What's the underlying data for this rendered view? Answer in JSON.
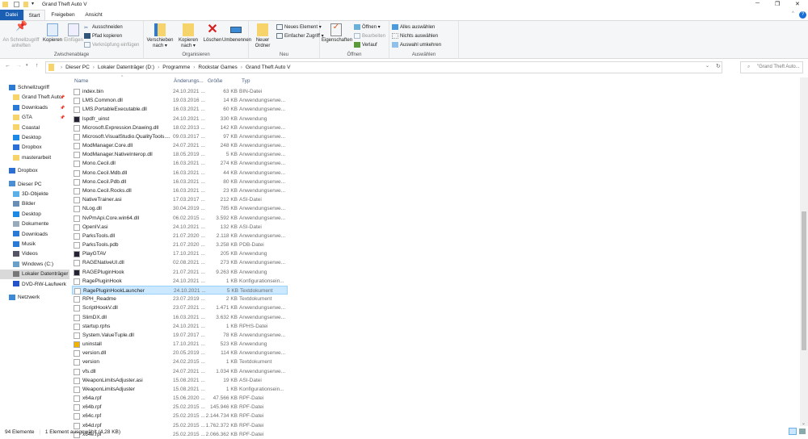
{
  "window": {
    "title": "Grand Theft Auto V",
    "minimize": "─",
    "maximize": "❐",
    "close": "✕"
  },
  "tabs": [
    "Datei",
    "Start",
    "Freigeben",
    "Ansicht"
  ],
  "ribbon": {
    "clipboard": {
      "label": "Zwischenablage",
      "pin": "An Schnellzugriff anheften",
      "copy": "Kopieren",
      "paste": "Einfügen",
      "cut": "Ausschneiden",
      "copy_path": "Pfad kopieren",
      "paste_link": "Verknüpfung einfügen"
    },
    "organize": {
      "label": "Organisieren",
      "move": "Verschieben nach ▾",
      "copyto": "Kopieren nach ▾",
      "delete": "Löschen",
      "rename": "Umbenennen"
    },
    "new": {
      "label": "Neu",
      "folder": "Neuer Ordner",
      "item": "Neues Element ▾",
      "easy": "Einfacher Zugriff ▾"
    },
    "open": {
      "label": "Öffnen",
      "props": "Eigenschaften",
      "open": "Öffnen ▾",
      "edit": "Bearbeiten",
      "history": "Verlauf"
    },
    "select": {
      "label": "Auswählen",
      "all": "Alles auswählen",
      "none": "Nichts auswählen",
      "invert": "Auswahl umkehren"
    }
  },
  "address": {
    "crumbs": [
      "Dieser PC",
      "Lokaler Datenträger (D:)",
      "Programme",
      "Rockstar Games",
      "Grand Theft Auto V"
    ],
    "search_placeholder": "\"Grand Theft Auto..."
  },
  "sidebar": [
    {
      "label": "Schnellzugriff",
      "color": "#2b7bd6",
      "indent": 0
    },
    {
      "label": "Grand Theft Auto",
      "color": "#f7d46b",
      "indent": 1,
      "pin": true
    },
    {
      "label": "Downloads",
      "color": "#2b7bd6",
      "indent": 1,
      "pin": true
    },
    {
      "label": "GTA",
      "color": "#f7d46b",
      "indent": 1,
      "pin": true
    },
    {
      "label": "Coastal",
      "color": "#f7d46b",
      "indent": 1
    },
    {
      "label": "Desktop",
      "color": "#1e88e5",
      "indent": 1
    },
    {
      "label": "Dropbox",
      "color": "#2b6fd6",
      "indent": 1
    },
    {
      "label": "masterarbeit",
      "color": "#f7d46b",
      "indent": 1
    },
    {
      "label": "Dropbox",
      "color": "#2b6fd6",
      "indent": 0,
      "gap": true
    },
    {
      "label": "Dieser PC",
      "color": "#4a8fd6",
      "indent": 0,
      "gap": true
    },
    {
      "label": "3D-Objekte",
      "color": "#5cb0e8",
      "indent": 1
    },
    {
      "label": "Bilder",
      "color": "#6a8fb5",
      "indent": 1
    },
    {
      "label": "Desktop",
      "color": "#1e88e5",
      "indent": 1
    },
    {
      "label": "Dokumente",
      "color": "#9ab",
      "indent": 1
    },
    {
      "label": "Downloads",
      "color": "#2b7bd6",
      "indent": 1
    },
    {
      "label": "Musik",
      "color": "#2b7bd6",
      "indent": 1
    },
    {
      "label": "Videos",
      "color": "#556",
      "indent": 1
    },
    {
      "label": "Windows (C:)",
      "color": "#6aa0c8",
      "indent": 1
    },
    {
      "label": "Lokaler Datenträger",
      "color": "#777",
      "indent": 1,
      "selected": true
    },
    {
      "label": "DVD-RW-Laufwerk",
      "color": "#2452c8",
      "indent": 1
    },
    {
      "label": "Netzwerk",
      "color": "#3c8ad6",
      "indent": 0,
      "gap": true
    }
  ],
  "columns": {
    "name": "Name",
    "date": "Änderungs...",
    "size": "Größe",
    "type": "Typ"
  },
  "files": [
    [
      "index.bin",
      "24.10.2021 ...",
      "63 KB",
      "BIN-Datei"
    ],
    [
      "LMS.Common.dll",
      "19.03.2016 ...",
      "14 KB",
      "Anwendungserwe..."
    ],
    [
      "LMS.PortableExecutable.dll",
      "16.03.2021 ...",
      "60 KB",
      "Anwendungserwe..."
    ],
    [
      "lspdfr_uinst",
      "24.10.2021 ...",
      "330 KB",
      "Anwendung"
    ],
    [
      "Microsoft.Expression.Drawing.dll",
      "18.02.2013 ...",
      "142 KB",
      "Anwendungserwe..."
    ],
    [
      "Microsoft.VisualStudio.QualityTools....",
      "09.03.2017 ...",
      "97 KB",
      "Anwendungserwe..."
    ],
    [
      "ModManager.Core.dll",
      "24.07.2021 ...",
      "248 KB",
      "Anwendungserwe..."
    ],
    [
      "ModManager.NativeInterop.dll",
      "18.05.2019 ...",
      "5 KB",
      "Anwendungserwe..."
    ],
    [
      "Mono.Cecil.dll",
      "16.03.2021 ...",
      "274 KB",
      "Anwendungserwe..."
    ],
    [
      "Mono.Cecil.Mdb.dll",
      "16.03.2021 ...",
      "44 KB",
      "Anwendungserwe..."
    ],
    [
      "Mono.Cecil.Pdb.dll",
      "16.03.2021 ...",
      "80 KB",
      "Anwendungserwe..."
    ],
    [
      "Mono.Cecil.Rocks.dll",
      "16.03.2021 ...",
      "23 KB",
      "Anwendungserwe..."
    ],
    [
      "NativeTrainer.asi",
      "17.03.2017 ...",
      "212 KB",
      "ASI-Datei"
    ],
    [
      "NLog.dll",
      "30.04.2019 ...",
      "785 KB",
      "Anwendungserwe..."
    ],
    [
      "NvPmApi.Core.win64.dll",
      "06.02.2015 ...",
      "3.592 KB",
      "Anwendungserwe..."
    ],
    [
      "OpenIV.asi",
      "24.10.2021 ...",
      "132 KB",
      "ASI-Datei"
    ],
    [
      "ParksTools.dll",
      "21.07.2020 ...",
      "2.118 KB",
      "Anwendungserwe..."
    ],
    [
      "ParksTools.pdb",
      "21.07.2020 ...",
      "3.258 KB",
      "PDB-Datei"
    ],
    [
      "PlayGTAV",
      "17.10.2021 ...",
      "205 KB",
      "Anwendung"
    ],
    [
      "RAGENativeUI.dll",
      "02.08.2021 ...",
      "273 KB",
      "Anwendungserwe..."
    ],
    [
      "RAGEPluginHook",
      "21.07.2021 ...",
      "9.263 KB",
      "Anwendung"
    ],
    [
      "RagePluginHook",
      "24.10.2021 ...",
      "1 KB",
      "Konfigurationsein..."
    ],
    [
      "RagePluginHookLauncher",
      "24.10.2021 ...",
      "5 KB",
      "Textdokument"
    ],
    [
      "RPH_Readme",
      "23.07.2019 ...",
      "2 KB",
      "Textdokument"
    ],
    [
      "ScriptHookV.dll",
      "23.07.2021 ...",
      "1.471 KB",
      "Anwendungserwe..."
    ],
    [
      "SlimDX.dll",
      "16.03.2021 ...",
      "3.632 KB",
      "Anwendungserwe..."
    ],
    [
      "startup.rphs",
      "24.10.2021 ...",
      "1 KB",
      "RPHS-Datei"
    ],
    [
      "System.ValueTuple.dll",
      "19.07.2017 ...",
      "78 KB",
      "Anwendungserwe..."
    ],
    [
      "uninstall",
      "17.10.2021 ...",
      "523 KB",
      "Anwendung"
    ],
    [
      "version.dll",
      "20.05.2019 ...",
      "114 KB",
      "Anwendungserwe..."
    ],
    [
      "version",
      "24.02.2015 ...",
      "1 KB",
      "Textdokument"
    ],
    [
      "vfs.dll",
      "24.07.2021 ...",
      "1.034 KB",
      "Anwendungserwe..."
    ],
    [
      "WeaponLimitsAdjuster.asi",
      "15.08.2021 ...",
      "19 KB",
      "ASI-Datei"
    ],
    [
      "WeaponLimitsAdjuster",
      "15.08.2021 ...",
      "1 KB",
      "Konfigurationsein..."
    ],
    [
      "x64a.rpf",
      "15.06.2020 ...",
      "47.566 KB",
      "RPF-Datei"
    ],
    [
      "x64b.rpf",
      "25.02.2015 ...",
      "145.946 KB",
      "RPF-Datei"
    ],
    [
      "x64c.rpf",
      "25.02.2015 ...",
      "2.144.734 KB",
      "RPF-Datei"
    ],
    [
      "x64d.rpf",
      "25.02.2015 ...",
      "1.762.372 KB",
      "RPF-Datei"
    ],
    [
      "x64e.rpf",
      "25.02.2015 ...",
      "2.066.362 KB",
      "RPF-Datei"
    ]
  ],
  "selected_index": 22,
  "status": {
    "count": "94 Elemente",
    "selection": "1 Element ausgewählt (4,28 KB)"
  }
}
